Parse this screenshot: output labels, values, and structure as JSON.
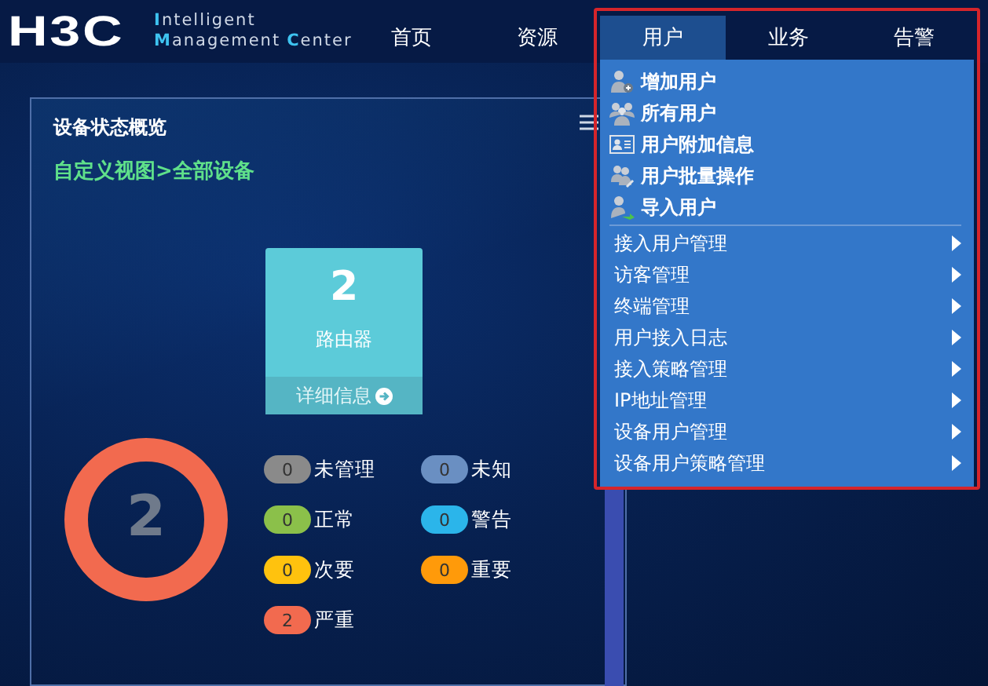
{
  "header": {
    "logo": "H3C",
    "product_lines": [
      "Intelligent",
      "Management",
      "Center"
    ],
    "nav": [
      {
        "label": "首页",
        "selected": false
      },
      {
        "label": "资源",
        "selected": false
      },
      {
        "label": "用户",
        "selected": true
      },
      {
        "label": "业务",
        "selected": false
      },
      {
        "label": "告警",
        "selected": false
      }
    ]
  },
  "user_menu": {
    "quick_items": [
      "增加用户",
      "所有用户",
      "用户附加信息",
      "用户批量操作",
      "导入用户"
    ],
    "submenu_items": [
      "接入用户管理",
      "访客管理",
      "终端管理",
      "用户接入日志",
      "接入策略管理",
      "IP地址管理",
      "设备用户管理",
      "设备用户策略管理"
    ]
  },
  "panel": {
    "title": "设备状态概览",
    "breadcrumb": "自定义视图>全部设备",
    "device_card": {
      "count": "2",
      "type": "路由器",
      "details_link": "详细信息"
    },
    "total": "2",
    "legend": [
      {
        "count": "0",
        "label": "未管理",
        "color": "#8a8a8a"
      },
      {
        "count": "0",
        "label": "未知",
        "color": "#6a8fc2"
      },
      {
        "count": "0",
        "label": "正常",
        "color": "#8bc04a"
      },
      {
        "count": "0",
        "label": "警告",
        "color": "#2bb5ea"
      },
      {
        "count": "0",
        "label": "次要",
        "color": "#ffc20e"
      },
      {
        "count": "0",
        "label": "重要",
        "color": "#ff9a0a"
      },
      {
        "count": "2",
        "label": "严重",
        "color": "#f26a4f"
      }
    ]
  }
}
